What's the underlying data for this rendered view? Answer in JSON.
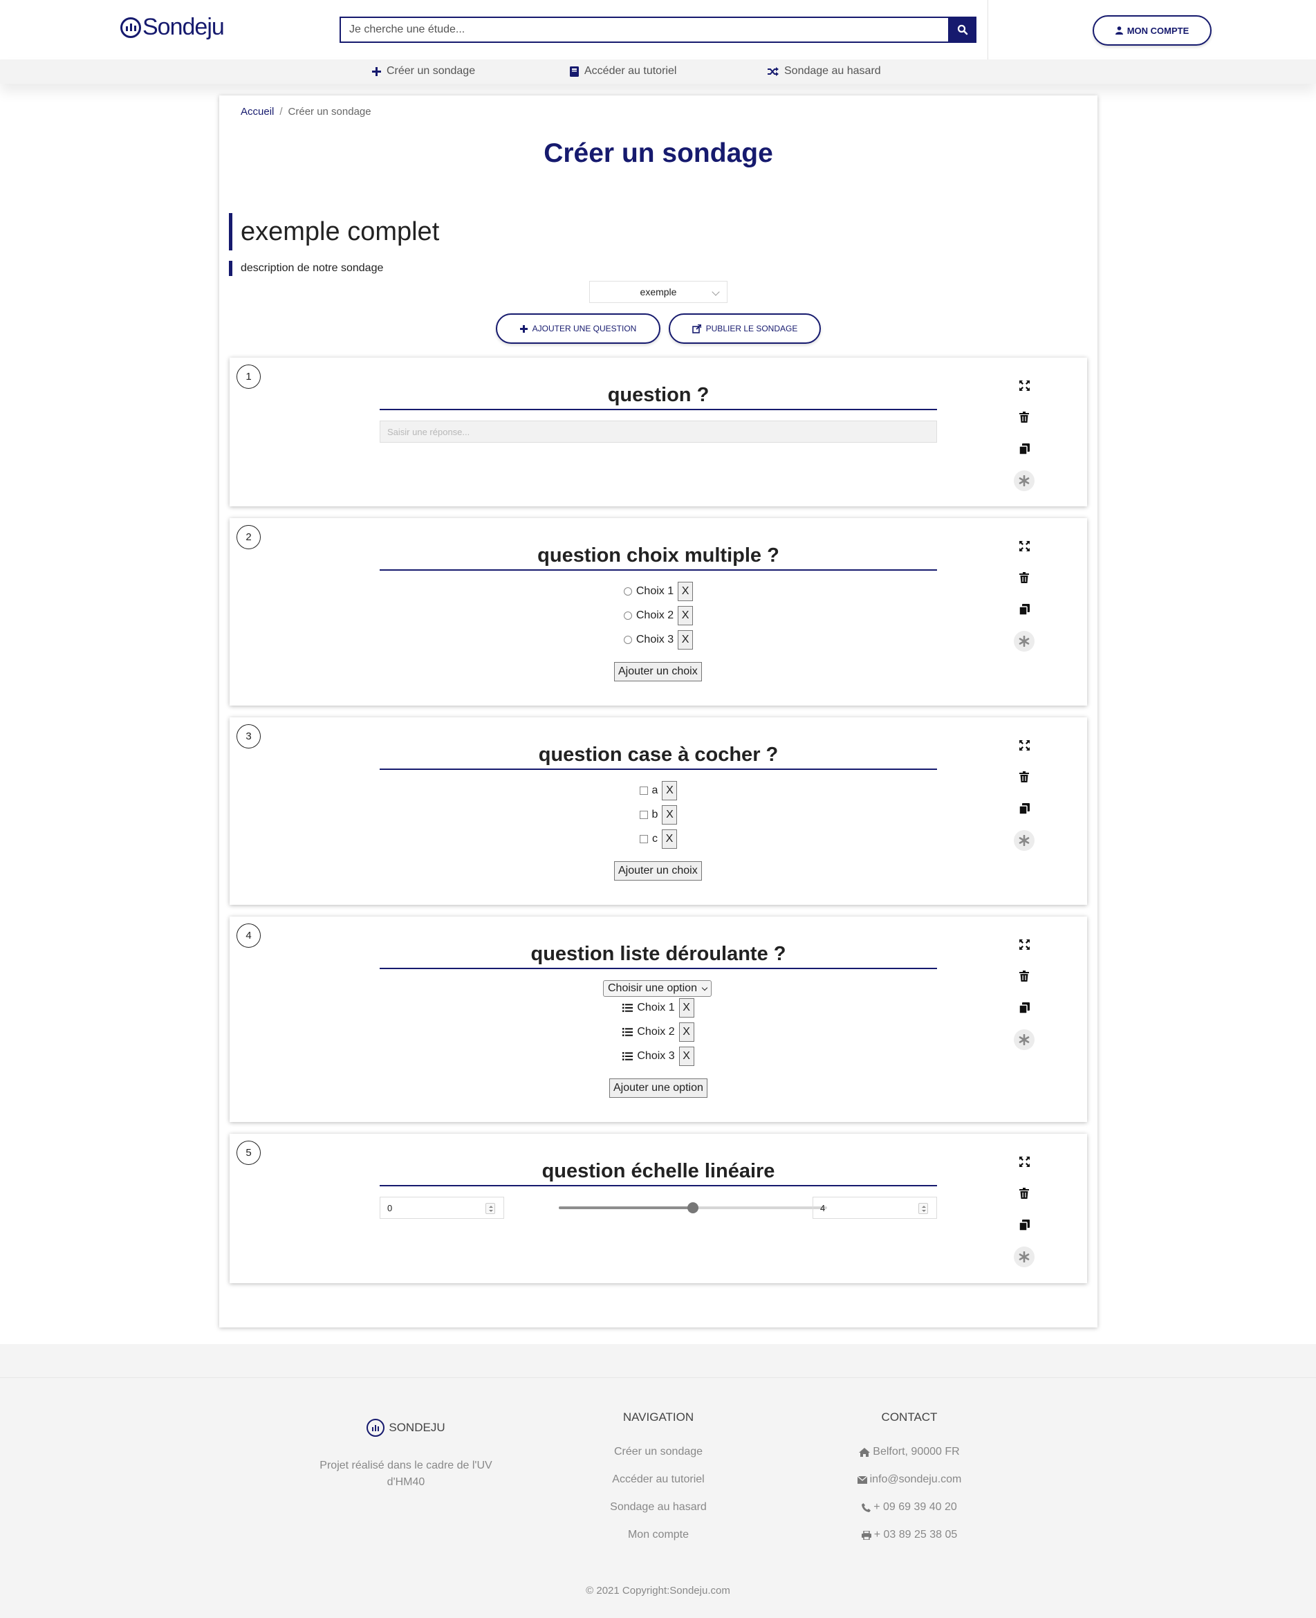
{
  "header": {
    "logo_text": "Sondeju",
    "search_placeholder": "Je cherche une étude...",
    "account_label": "MON COMPTE"
  },
  "subnav": [
    {
      "label": "Créer un sondage",
      "icon": "plus-icon"
    },
    {
      "label": "Accéder au tutoriel",
      "icon": "book-icon"
    },
    {
      "label": "Sondage au hasard",
      "icon": "random-icon"
    }
  ],
  "breadcrumb": {
    "home": "Accueil",
    "separator": "/",
    "current": "Créer un sondage"
  },
  "page_title": "Créer un sondage",
  "survey": {
    "title": "exemple complet",
    "description": "description de notre sondage",
    "category_selected": "exemple"
  },
  "actions": {
    "add_question": "AJOUTER UNE QUESTION",
    "publish": "PUBLIER LE SONDAGE"
  },
  "questions": [
    {
      "number": "1",
      "title": "question ?",
      "type": "text",
      "placeholder": "Saisir une réponse..."
    },
    {
      "number": "2",
      "title": "question choix multiple ?",
      "type": "radio",
      "options": [
        "Choix 1",
        "Choix 2",
        "Choix 3"
      ],
      "remove_label": "X",
      "add_label": "Ajouter un choix"
    },
    {
      "number": "3",
      "title": "question case à cocher ?",
      "type": "checkbox",
      "options": [
        "a",
        "b",
        "c"
      ],
      "remove_label": "X",
      "add_label": "Ajouter un choix"
    },
    {
      "number": "4",
      "title": "question liste déroulante ?",
      "type": "dropdown",
      "select_placeholder": "Choisir une option",
      "options": [
        "Choix 1",
        "Choix 2",
        "Choix 3"
      ],
      "remove_label": "X",
      "add_label": "Ajouter une option"
    },
    {
      "number": "5",
      "title": "question échelle linéaire",
      "type": "scale",
      "min": "0",
      "max": "4",
      "slider_fraction": 0.5
    }
  ],
  "question_tools": [
    "expand-icon",
    "trash-icon",
    "copy-icon",
    "required-asterisk-icon"
  ],
  "footer": {
    "brand": "SONDEJU",
    "description": "Projet réalisé dans le cadre de l'UV d'HM40",
    "nav_heading": "NAVIGATION",
    "nav_links": [
      "Créer un sondage",
      "Accéder au tutoriel",
      "Sondage au hasard",
      "Mon compte"
    ],
    "contact_heading": "CONTACT",
    "contact": [
      {
        "icon": "home-icon",
        "text": "Belfort, 90000 FR"
      },
      {
        "icon": "envelope-icon",
        "text": "info@sondeju.com"
      },
      {
        "icon": "phone-icon",
        "text": "+ 09 69 39 40 20"
      },
      {
        "icon": "printer-icon",
        "text": "+ 03 89 25 38 05"
      }
    ],
    "copyright": "© 2021 Copyright:Sondeju.com"
  },
  "colors": {
    "brand": "#161a6e",
    "footer_bg": "#f4f4f4"
  }
}
